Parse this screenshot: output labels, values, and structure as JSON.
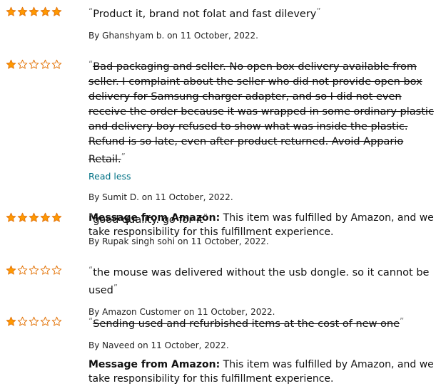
{
  "reviews": [
    {
      "rating": 5,
      "text": "Product it, brand not folat and fast dilevery",
      "strikethrough": false,
      "byline": "By Ghanshyam b. on 11 October, 2022."
    },
    {
      "rating": 1,
      "text": "Bad packaging and seller. No open box delivery available from seller. I complaint about the seller who did not provide open box delivery for Samsung charger adapter, and so I did not even receive the order because it was wrapped in some ordinary plastic and delivery boy refused to show what was inside the plastic. Refund is so late, even after product returned. Avoid Appario Retail.",
      "strikethrough": true,
      "read_less": "Read less",
      "byline": "By Sumit D. on 11 October, 2022.",
      "message_label": "Message from Amazon:",
      "message_text": "This item was fulfilled by Amazon, and we take responsibility for this fulfillment experience."
    },
    {
      "rating": 5,
      "text": "good quality. go for it",
      "strikethrough": false,
      "byline": "By Rupak singh sohi on 11 October, 2022."
    },
    {
      "rating": 1,
      "text": "the mouse was delivered without the usb dongle. so it cannot be used",
      "strikethrough": false,
      "byline": "By Amazon Customer on 11 October, 2022."
    },
    {
      "rating": 1,
      "text": "Sending used and refurbished items at the cost of new one",
      "strikethrough": true,
      "byline": "By Naveed on 11 October, 2022.",
      "message_label": "Message from Amazon:",
      "message_text": "This item was fulfilled by Amazon, and we take responsibility for this fulfillment experience."
    }
  ],
  "quote_open": "“",
  "quote_close": "”",
  "colors": {
    "star_fill": "#ff9900",
    "star_stroke": "#e47911",
    "link": "#007185"
  },
  "icons": {
    "star_filled": "star-filled-icon",
    "star_empty": "star-empty-icon"
  }
}
